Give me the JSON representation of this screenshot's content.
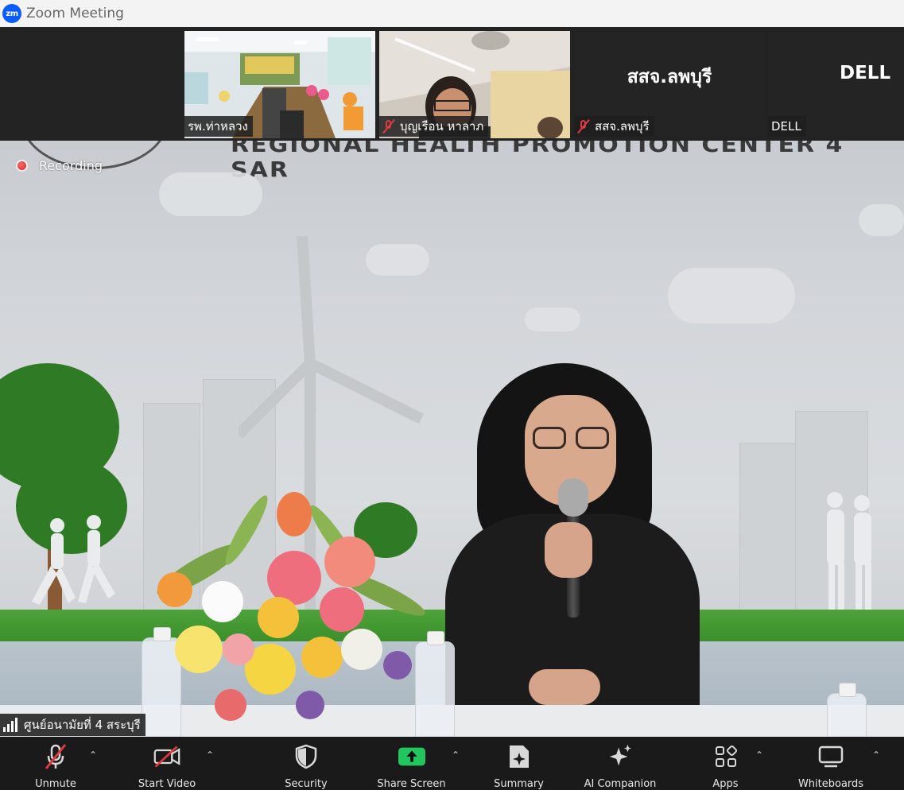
{
  "window": {
    "logo_text": "zm",
    "title": "Zoom Meeting"
  },
  "participants": [
    {
      "name": "รพ.ท่าหลวง",
      "muted": false,
      "has_video": true
    },
    {
      "name": "บุญเรือน หาลาภ",
      "muted": true,
      "has_video": true
    },
    {
      "name": "สสจ.ลพบุรี",
      "display": "สสจ.ลพบุรี",
      "muted": true,
      "has_video": false
    },
    {
      "name": "DELL",
      "display": "DELL",
      "muted": false,
      "has_video": false
    }
  ],
  "main_video": {
    "banner": "REGIONAL HEALTH PROMOTION CENTER 4 SAR",
    "recording_label": "Recording",
    "speaker_name": "ศูนย์อนามัยที่ 4 สระบุรี"
  },
  "toolbar": {
    "items": [
      {
        "label": "Unmute",
        "icon": "microphone-muted-icon"
      },
      {
        "label": "Start Video",
        "icon": "video-off-icon"
      },
      {
        "label": "Security",
        "icon": "shield-icon"
      },
      {
        "label": "Share Screen",
        "icon": "share-screen-icon"
      },
      {
        "label": "Summary",
        "icon": "summary-icon"
      },
      {
        "label": "AI Companion",
        "icon": "sparkle-icon"
      },
      {
        "label": "Apps",
        "icon": "apps-icon"
      },
      {
        "label": "Whiteboards",
        "icon": "whiteboard-icon"
      }
    ]
  },
  "colors": {
    "zoom_blue": "#0b5cff",
    "mute_red": "#e0393e",
    "share_green": "#22c55e",
    "toolbar_bg": "#1a1a1a"
  }
}
